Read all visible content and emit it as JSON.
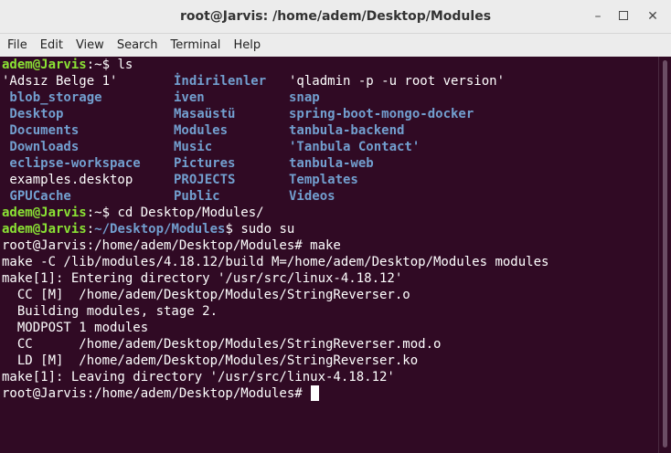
{
  "window": {
    "title": "root@Jarvis: /home/adem/Desktop/Modules",
    "minimize_glyph": "–",
    "close_glyph": "✕"
  },
  "menu": [
    "File",
    "Edit",
    "View",
    "Search",
    "Terminal",
    "Help"
  ],
  "prompt_user": "adem@Jarvis",
  "lines": {
    "l1_sep": ":~$ ",
    "l1_cmd": "ls",
    "ls_rows": [
      [
        "'Adsız Belge 1'",
        "İndirilenler",
        "'qladmin -p -u root version'"
      ],
      [
        " blob_storage",
        "iven",
        "snap"
      ],
      [
        " Desktop",
        "Masaüstü",
        "spring-boot-mongo-docker"
      ],
      [
        " Documents",
        "Modules",
        "tanbula-backend"
      ],
      [
        " Downloads",
        "Music",
        "'Tanbula Contact'"
      ],
      [
        " eclipse-workspace",
        "Pictures",
        "tanbula-web"
      ],
      [
        " examples.desktop",
        "PROJECTS",
        "Templates"
      ],
      [
        " GPUCache",
        "Public",
        "Videos"
      ]
    ],
    "l10_sep": ":~$ ",
    "l10_cmd": "cd Desktop/Modules/",
    "l11_path": "~/Desktop/Modules",
    "l11_sep": "$ ",
    "l11_cmd": "sudo su",
    "l12": "root@Jarvis:/home/adem/Desktop/Modules# make",
    "l13": "make -C /lib/modules/4.18.12/build M=/home/adem/Desktop/Modules modules",
    "l14": "make[1]: Entering directory '/usr/src/linux-4.18.12'",
    "l15": "  CC [M]  /home/adem/Desktop/Modules/StringReverser.o",
    "l16": "  Building modules, stage 2.",
    "l17": "  MODPOST 1 modules",
    "l18": "  CC      /home/adem/Desktop/Modules/StringReverser.mod.o",
    "l19": "  LD [M]  /home/adem/Desktop/Modules/StringReverser.ko",
    "l20": "make[1]: Leaving directory '/usr/src/linux-4.18.12'",
    "l21": "root@Jarvis:/home/adem/Desktop/Modules# "
  },
  "colors": {
    "background": "#300a24",
    "user": "#8ae234",
    "path": "#729fcf",
    "text": "#ffffff"
  }
}
